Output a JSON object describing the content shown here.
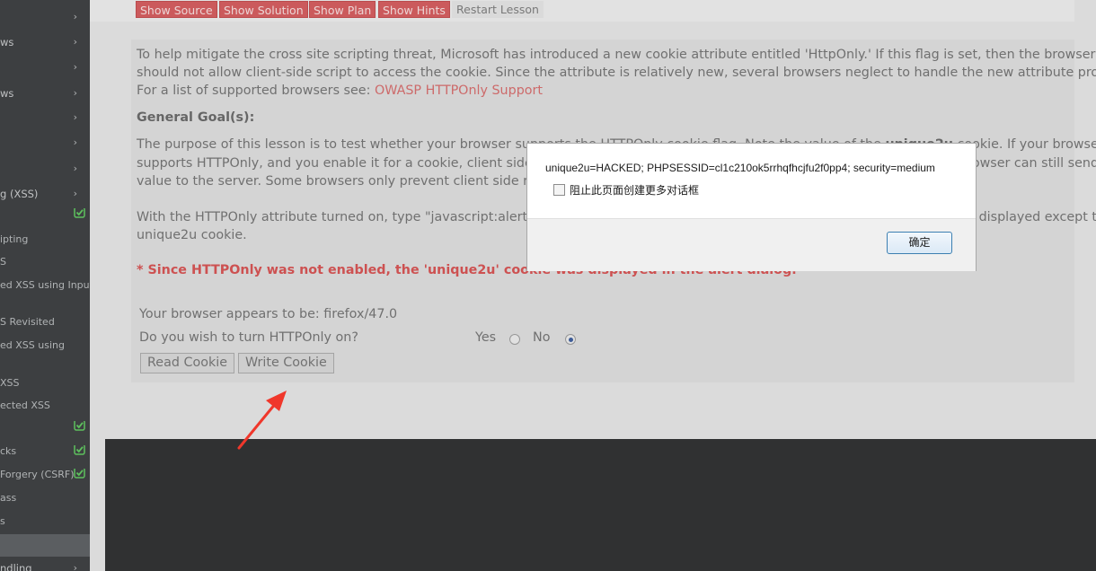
{
  "sidebar": {
    "items": [
      {
        "label": "",
        "chevron": "›",
        "check": false
      },
      {
        "label": "ws",
        "chevron": "›",
        "check": false
      },
      {
        "label": "",
        "chevron": "›",
        "check": false
      },
      {
        "label": "ws",
        "chevron": "›",
        "check": false
      },
      {
        "label": "",
        "chevron": "›",
        "check": false
      },
      {
        "label": "",
        "chevron": "›",
        "check": false
      },
      {
        "label": "",
        "chevron": "›",
        "check": false
      },
      {
        "label": "g (XSS)",
        "chevron": "›",
        "check": false
      },
      {
        "label": "",
        "chevron": "",
        "check": true
      },
      {
        "label": "ipting",
        "chevron": "",
        "check": false
      },
      {
        "label": "S",
        "chevron": "",
        "check": false
      },
      {
        "label": "ed XSS using Input",
        "chevron": "",
        "check": false
      },
      {
        "label": "S Revisited",
        "chevron": "",
        "check": false
      },
      {
        "label": "ed XSS using",
        "chevron": "",
        "check": false
      },
      {
        "label": "XSS",
        "chevron": "",
        "check": false
      },
      {
        "label": "ected XSS",
        "chevron": "",
        "check": false
      },
      {
        "label": "",
        "chevron": "",
        "check": true
      },
      {
        "label": "cks",
        "chevron": "",
        "check": true
      },
      {
        "label": "Forgery (CSRF)",
        "chevron": "",
        "check": true
      },
      {
        "label": "ass",
        "chevron": "",
        "check": false
      },
      {
        "label": "s",
        "chevron": "",
        "check": false
      },
      {
        "label": "",
        "chevron": "",
        "check": false
      },
      {
        "label": "ndling",
        "chevron": "›",
        "check": false
      }
    ]
  },
  "toolbar": {
    "show_source": "Show Source",
    "show_solution": "Show Solution",
    "show_plan": "Show Plan",
    "show_hints": "Show Hints",
    "restart_lesson": "Restart Lesson"
  },
  "lesson": {
    "intro_line1": "To help mitigate the cross site scripting threat, Microsoft has introduced a new cookie attribute entitled 'HttpOnly.' If this flag is set, then the browser",
    "intro_line2": "should not allow client-side script to access the cookie. Since the attribute is relatively new, several browsers neglect to handle the new attribute properly.",
    "intro_line3": "For a list of supported browsers see:",
    "intro_link": "OWASP HTTPOnly Support",
    "goal_heading": "General Goal(s):",
    "purpose_line1_a": "The purpose of this lesson is to test whether your browser supports the HTTPOnly cookie flag. Note the value of the",
    "purpose_line1_bold": "unique2u",
    "purpose_line1_b": "cookie. If your browser",
    "purpose_line2": "supports HTTPOnly, and you enable it for a cookie, client side code should NOT be able to read OR write to that cookie, but the browser can still send its",
    "purpose_line3": "value to the server. Some browsers only prevent client side read access, but don't prevent write access.",
    "with_line1": "With the HTTPOnly attribute turned on, type \"javascript:alert(document.cookie)\" in the browser address bar. Notice all cookies are displayed except the",
    "with_line2": "unique2u cookie.",
    "warning": "* Since HTTPOnly was not enabled, the 'unique2u' cookie was displayed in the alert dialog."
  },
  "form": {
    "browser_info": "Your browser appears to be: firefox/47.0",
    "question": "Do you wish to turn HTTPOnly on?",
    "yes_label": "Yes",
    "no_label": "No",
    "selected": "No",
    "read_cookie": "Read Cookie",
    "write_cookie": "Write Cookie"
  },
  "dialog": {
    "message": "unique2u=HACKED; PHPSESSID=cl1c210ok5rrhqfhcjfu2f0pp4; security=medium",
    "checkbox_label": "阻止此页面创建更多对话框",
    "checkbox_checked": false,
    "ok_label": "确定"
  },
  "colors": {
    "accent_red": "#d2595b",
    "sidebar_bg": "#3a3c3e",
    "check_green": "#5cc85c",
    "arrow_red": "#f0372b"
  }
}
